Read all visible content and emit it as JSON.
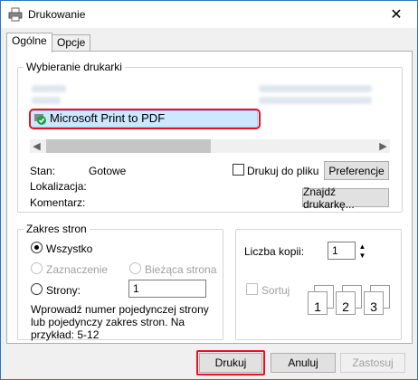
{
  "window": {
    "title": "Drukowanie",
    "close_glyph": "✕"
  },
  "tabs": [
    {
      "label": "Ogólne"
    },
    {
      "label": "Opcje"
    }
  ],
  "printer_selection": {
    "legend": "Wybieranie drukarki",
    "selected_printer": "Microsoft Print to PDF"
  },
  "status": {
    "stan_label": "Stan:",
    "stan_value": "Gotowe",
    "lokalizacja_label": "Lokalizacja:",
    "komentarz_label": "Komentarz:",
    "print_to_file_label": "Drukuj do pliku",
    "preferences_button": "Preferencje",
    "find_printer_button": "Znajdź drukarkę..."
  },
  "page_range": {
    "legend": "Zakres stron",
    "all_label": "Wszystko",
    "selection_label": "Zaznaczenie",
    "current_page_label": "Bieżąca strona",
    "pages_label": "Strony:",
    "pages_value": "1",
    "hint": "Wprowadź numer pojedynczej strony lub pojedynczy zakres stron. Na przykład: 5-12"
  },
  "copies": {
    "label": "Liczba kopii:",
    "value": "1",
    "collate_label": "Sortuj",
    "collate_icons": [
      "1",
      "1",
      "2",
      "2",
      "3",
      "3"
    ]
  },
  "buttons": {
    "print": "Drukuj",
    "cancel": "Anuluj",
    "apply": "Zastosuj"
  },
  "colors": {
    "accent": "#2b78c4",
    "highlight": "#e81123",
    "selection": "#cce8ff"
  }
}
